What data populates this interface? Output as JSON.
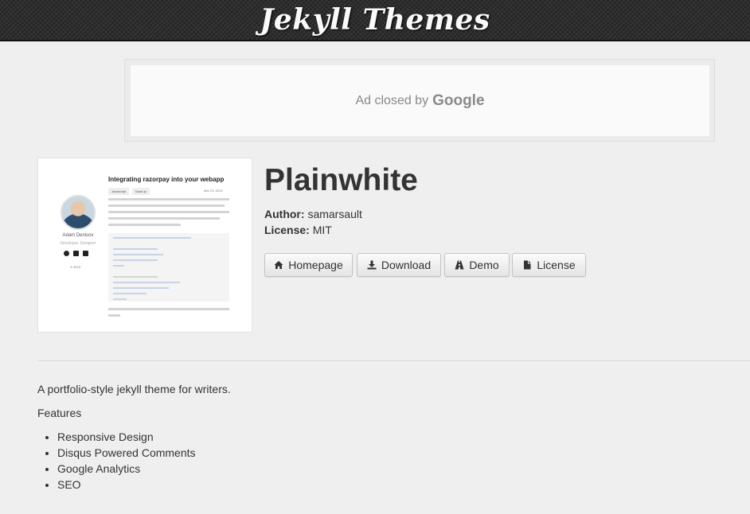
{
  "header": {
    "site_title": "Jekyll Themes"
  },
  "ad": {
    "text": "Ad closed by",
    "brand": "Google"
  },
  "preview": {
    "post_title": "Integrating razorpay into your webapp",
    "author_name": "Adam Denisov",
    "author_role": "Developer, Designer",
    "tags": [
      "Javascript",
      "Node.js"
    ],
    "date": "Mar 23, 2019",
    "copyright": "© 2019"
  },
  "theme": {
    "name": "Plainwhite",
    "author_label": "Author:",
    "author": "samarsault",
    "license_label": "License:",
    "license": "MIT"
  },
  "buttons": {
    "homepage": "Homepage",
    "download": "Download",
    "demo": "Demo",
    "license": "License"
  },
  "content": {
    "description": "A portfolio-style jekyll theme for writers.",
    "features_heading": "Features",
    "features": [
      "Responsive Design",
      "Disqus Powered Comments",
      "Google Analytics",
      "SEO"
    ]
  },
  "icons": {
    "homepage": "home-icon",
    "download": "download-icon",
    "demo": "road-icon",
    "license": "file-icon"
  }
}
